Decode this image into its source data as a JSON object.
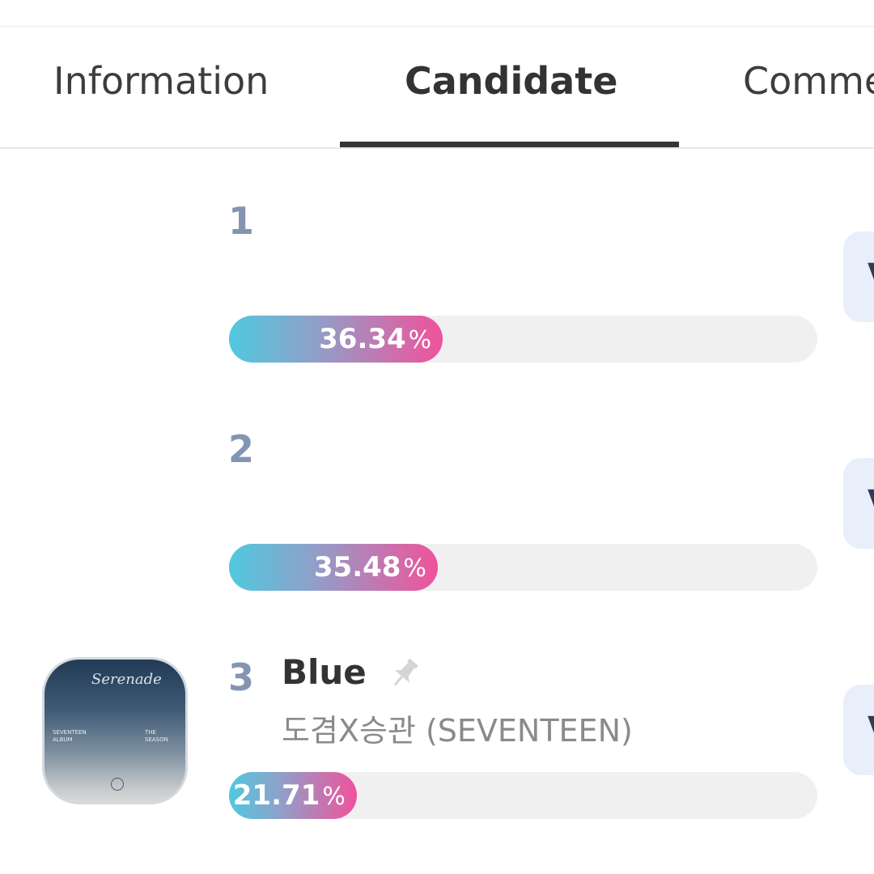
{
  "tabs": [
    {
      "label": "Information"
    },
    {
      "label": "Candidate",
      "active": true
    },
    {
      "label": "Comme"
    }
  ],
  "candidates": [
    {
      "rank": "1",
      "percent": "36.34",
      "percent_value": 36.34,
      "vote_label": "V"
    },
    {
      "rank": "2",
      "percent": "35.48",
      "percent_value": 35.48,
      "vote_label": "V"
    },
    {
      "rank": "3",
      "percent": "21.71",
      "percent_value": 21.71,
      "vote_label": "V",
      "title": "Blue",
      "artist": "도겸X승관 (SEVENTEEN)",
      "pin_icon": "pin-icon"
    }
  ],
  "percent_unit": "%",
  "colors": {
    "gradient_start": "#4fc9df",
    "gradient_end": "#f0529c",
    "rank": "#8494b3",
    "vote_button_bg": "#e8eefa"
  }
}
